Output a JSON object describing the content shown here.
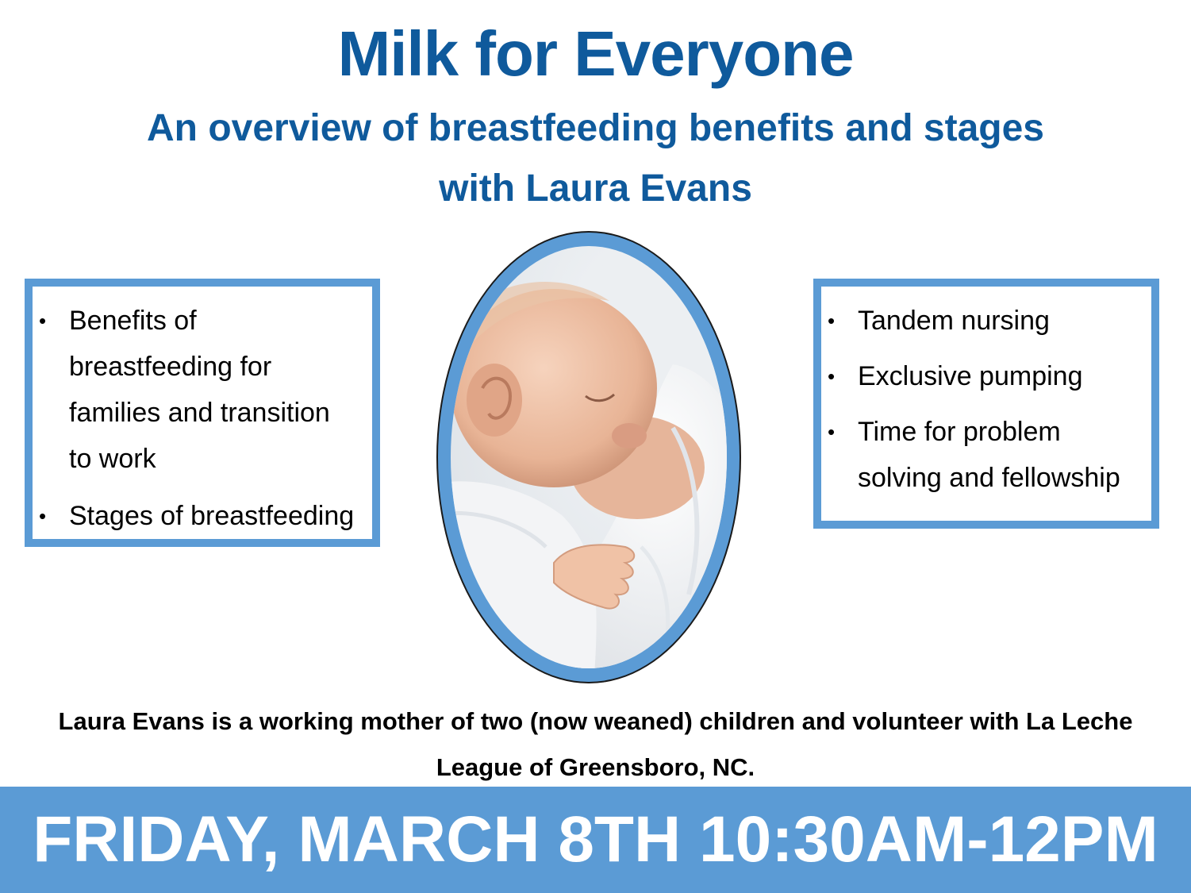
{
  "colors": {
    "heading": "#0f5a9c",
    "accent_blue": "#5b9bd5",
    "banner_text": "#ffffff",
    "body_text": "#000000"
  },
  "header": {
    "title": "Milk for Everyone",
    "subtitle_line1": "An overview of breastfeeding benefits and stages",
    "subtitle_line2": "with Laura Evans"
  },
  "left_box": {
    "items": [
      {
        "bullet": "•",
        "lines": [
          "Benefits of",
          "breastfeeding for",
          "families and transition",
          "to work"
        ]
      },
      {
        "bullet": "•",
        "lines": [
          "Stages of breastfeeding"
        ]
      }
    ]
  },
  "right_box": {
    "items": [
      {
        "bullet": "•",
        "lines": [
          "Tandem nursing"
        ]
      },
      {
        "bullet": "•",
        "lines": [
          "Exclusive pumping"
        ]
      },
      {
        "bullet": "•",
        "lines": [
          "Time for problem",
          "solving and fellowship"
        ]
      }
    ]
  },
  "photo": {
    "subject": "newborn-breastfeeding-photo"
  },
  "bio": {
    "line1": "Laura Evans is a working mother of two (now weaned) children and volunteer with La Leche",
    "line2": "League of Greensboro, NC."
  },
  "banner": {
    "text": "FRIDAY, MARCH 8TH 10:30AM-12PM"
  }
}
